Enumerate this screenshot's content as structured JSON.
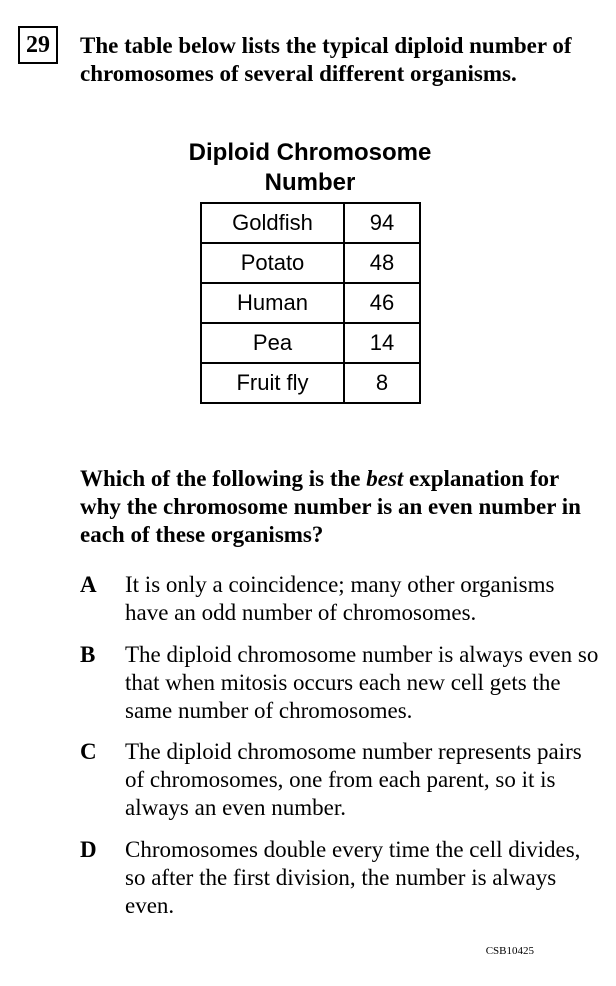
{
  "question": {
    "number": "29",
    "stem": "The table below lists the typical diploid number of chromosomes of several different organisms.",
    "prompt_before": "Which of the following is the ",
    "prompt_emphasis": "best",
    "prompt_after": " explanation for why the chromosome number is an even number in each of these organisms?"
  },
  "table": {
    "title": "Diploid Chromosome Number",
    "rows": [
      {
        "organism": "Goldfish",
        "number": "94"
      },
      {
        "organism": "Potato",
        "number": "48"
      },
      {
        "organism": "Human",
        "number": "46"
      },
      {
        "organism": "Pea",
        "number": "14"
      },
      {
        "organism": "Fruit fly",
        "number": "8"
      }
    ]
  },
  "options": [
    {
      "letter": "A",
      "text": "It is only a coincidence; many other organisms have an odd number of chromosomes."
    },
    {
      "letter": "B",
      "text": "The diploid chromosome number is always even so that when mitosis occurs each new cell gets the same number of chromosomes."
    },
    {
      "letter": "C",
      "text": "The diploid chromosome number represents pairs of chromosomes, one from each parent, so it is always an even number."
    },
    {
      "letter": "D",
      "text": "Chromosomes double every time the cell divides, so after the first division, the number is always even."
    }
  ],
  "footer": {
    "code": "CSB10425"
  }
}
